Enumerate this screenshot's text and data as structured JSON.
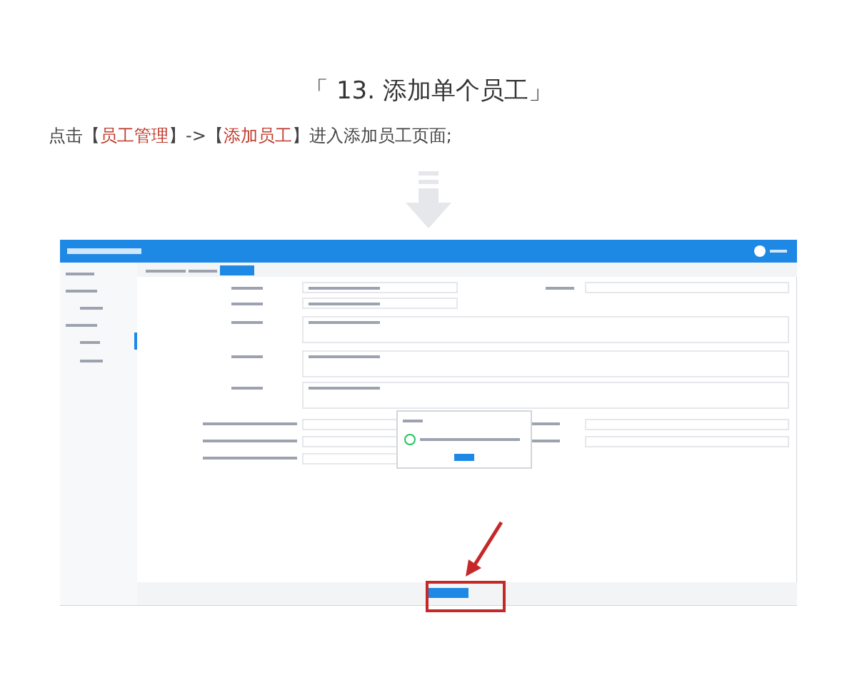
{
  "heading": "「 13. 添加单个员工」",
  "instruction": [
    {
      "text": "点击",
      "highlight": false
    },
    {
      "text": "【",
      "highlight": false
    },
    {
      "text": "员工管理",
      "highlight": true
    },
    {
      "text": "】->【",
      "highlight": false
    },
    {
      "text": "添加员工",
      "highlight": true
    },
    {
      "text": "】进入添加员工页面;",
      "highlight": false
    }
  ]
}
